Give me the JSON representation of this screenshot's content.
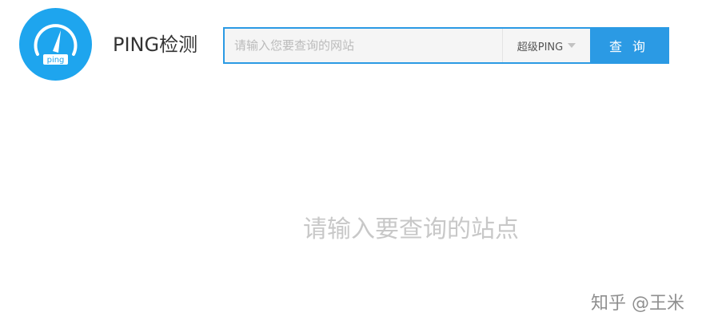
{
  "header": {
    "logo_label": "ping",
    "title": "PING检测"
  },
  "search": {
    "placeholder": "请输入您要查询的网站",
    "value": "",
    "mode_selected": "超级PING",
    "submit_label": "查 询"
  },
  "main": {
    "empty_hint": "请输入要查询的站点"
  },
  "watermark": "知乎 @王米",
  "colors": {
    "accent": "#2b9ae4",
    "logo_bg": "#1ea5ee",
    "hint_text": "#c8c8c8"
  },
  "icons": [
    "speedometer-icon",
    "caret-down-icon"
  ]
}
